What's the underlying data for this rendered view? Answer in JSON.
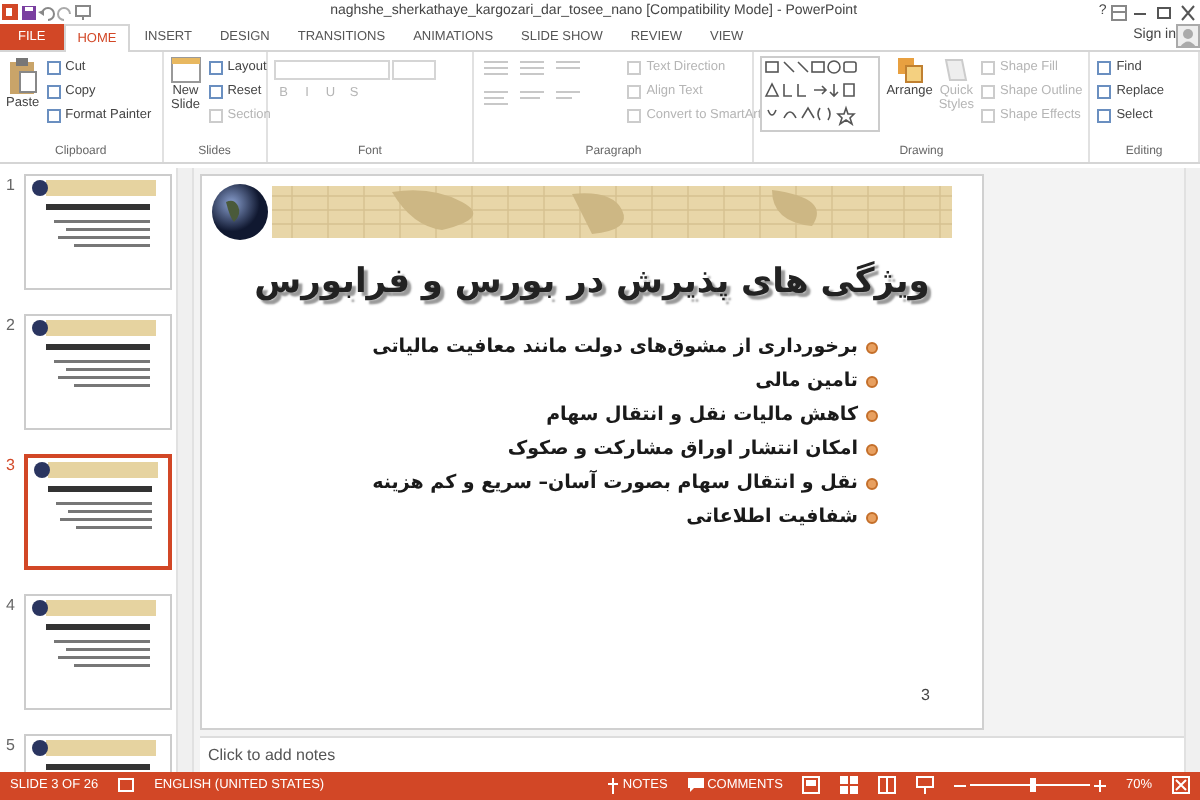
{
  "window": {
    "title": "naghshe_sherkathaye_kargozari_dar_tosee_nano [Compatibility Mode] - PowerPoint",
    "help": "?"
  },
  "tabs": [
    {
      "label": "FILE",
      "kind": "file",
      "selected": false
    },
    {
      "label": "HOME",
      "kind": "tab",
      "selected": true
    },
    {
      "label": "INSERT",
      "kind": "tab",
      "selected": false
    },
    {
      "label": "DESIGN",
      "kind": "tab",
      "selected": false
    },
    {
      "label": "TRANSITIONS",
      "kind": "tab",
      "selected": false
    },
    {
      "label": "ANIMATIONS",
      "kind": "tab",
      "selected": false
    },
    {
      "label": "SLIDE SHOW",
      "kind": "tab",
      "selected": false
    },
    {
      "label": "REVIEW",
      "kind": "tab",
      "selected": false
    },
    {
      "label": "VIEW",
      "kind": "tab",
      "selected": false
    }
  ],
  "sign_in": "Sign in",
  "ribbon": {
    "clipboard": {
      "label": "Clipboard",
      "paste": "Paste",
      "small": [
        {
          "label": "Cut",
          "disabled": false
        },
        {
          "label": "Copy",
          "disabled": false
        },
        {
          "label": "Format Painter",
          "disabled": false
        }
      ]
    },
    "slides": {
      "label": "Slides",
      "new_slide": "New Slide",
      "small": [
        {
          "label": "Layout",
          "disabled": false
        },
        {
          "label": "Reset",
          "disabled": false
        },
        {
          "label": "Section",
          "disabled": true
        }
      ]
    },
    "font": {
      "label": "Font",
      "buttons": [
        "B",
        "I",
        "U",
        "S"
      ],
      "disabled": true
    },
    "paragraph": {
      "label": "Paragraph",
      "small": [
        {
          "label": "Text Direction",
          "disabled": true
        },
        {
          "label": "Align Text",
          "disabled": true
        },
        {
          "label": "Convert to SmartArt",
          "disabled": true
        }
      ]
    },
    "drawing": {
      "label": "Drawing",
      "arrange": "Arrange",
      "quick_styles": "Quick Styles",
      "small": [
        {
          "label": "Shape Fill",
          "disabled": true
        },
        {
          "label": "Shape Outline",
          "disabled": true
        },
        {
          "label": "Shape Effects",
          "disabled": true
        }
      ]
    },
    "editing": {
      "label": "Editing",
      "small": [
        {
          "label": "Find",
          "disabled": false
        },
        {
          "label": "Replace",
          "disabled": false
        },
        {
          "label": "Select",
          "disabled": false
        }
      ]
    }
  },
  "thumbnails": [
    {
      "number": "1",
      "selected": false
    },
    {
      "number": "2",
      "selected": false
    },
    {
      "number": "3",
      "selected": true
    },
    {
      "number": "4",
      "selected": false
    },
    {
      "number": "5",
      "selected": false
    }
  ],
  "slide": {
    "title": "ویژگی های پذیرش در بورس و فرابورس",
    "bullets": [
      "برخورداری از مشوق‌های دولت مانند معافیت مالیاتی",
      "تامین مالی",
      "کاهش مالیات نقل و انتقال سهام",
      "امکان انتشار اوراق مشارکت و صکوک",
      "نقل و انتقال  سهام بصورت آسان–  سریع و کم هزینه",
      "شفافیت اطلاعاتی"
    ],
    "page_number": "3"
  },
  "notes": {
    "placeholder": "Click to add notes"
  },
  "status_bar": {
    "slide": "SLIDE 3 OF 26",
    "language": "ENGLISH (UNITED STATES)",
    "notes": "NOTES",
    "comments": "COMMENTS",
    "zoom": "70%",
    "zoom_level": {
      "level": 0.5
    }
  }
}
